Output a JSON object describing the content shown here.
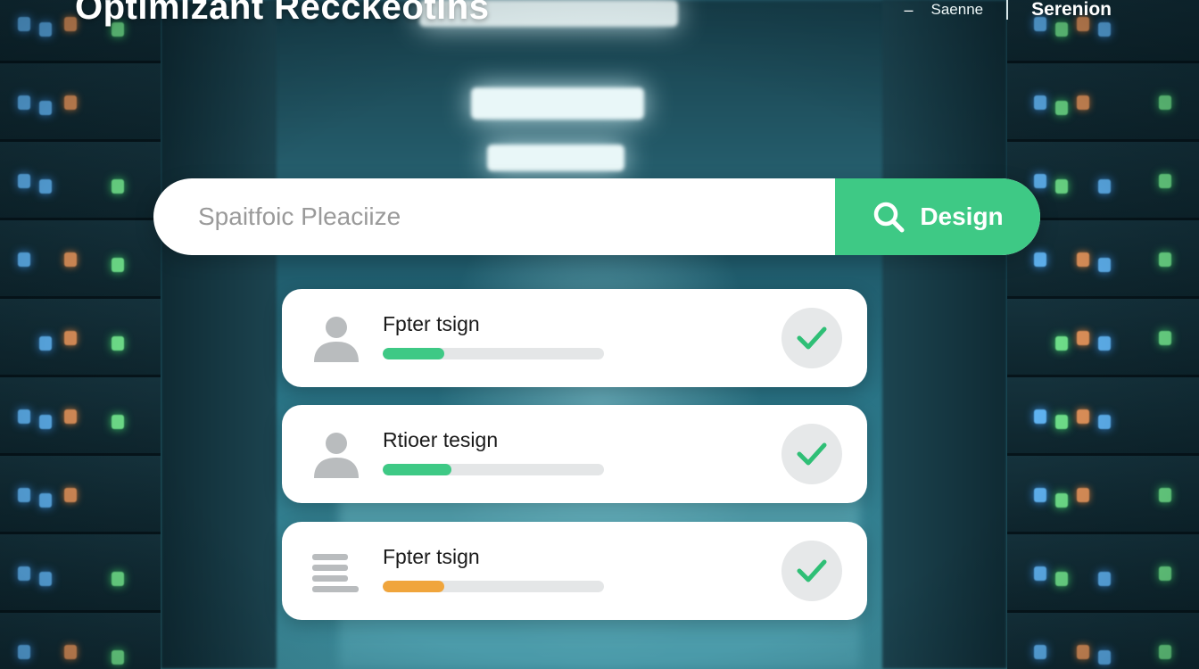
{
  "header": {
    "title": "Optimizant Recckeotins",
    "nav_items": [
      {
        "label": "Saenne"
      },
      {
        "label": "Serenion"
      }
    ]
  },
  "search": {
    "placeholder": "Spaitfoic Pleaciize",
    "value": "",
    "button_label": "Design",
    "icon": "search-icon"
  },
  "results": [
    {
      "title": "Fpter tsign",
      "icon": "user-icon",
      "progress": 0.28,
      "progress_color": "#3ec985",
      "status_icon": "check-icon",
      "check_color": "#2fbf76"
    },
    {
      "title": "Rtioer tesign",
      "icon": "user-icon",
      "progress": 0.31,
      "progress_color": "#3ec985",
      "status_icon": "check-icon",
      "check_color": "#2fbf76"
    },
    {
      "title": "Fpter tsign",
      "icon": "list-icon",
      "progress": 0.28,
      "progress_color": "#f0a53c",
      "status_icon": "check-icon",
      "check_color": "#2fbf76"
    }
  ],
  "colors": {
    "accent": "#3ec985",
    "warning": "#f0a53c",
    "track": "#e4e6e7"
  }
}
